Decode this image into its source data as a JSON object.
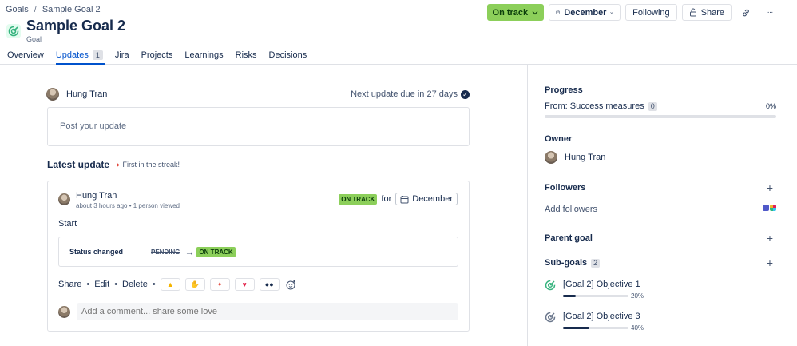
{
  "breadcrumb": {
    "root": "Goals",
    "separator": "/",
    "current": "Sample Goal 2"
  },
  "header": {
    "title": "Sample Goal 2",
    "subtitle": "Goal",
    "status_label": "On track",
    "month_label": "December",
    "following_label": "Following",
    "share_label": "Share",
    "more_label": "···"
  },
  "tabs": [
    {
      "label": "Overview"
    },
    {
      "label": "Updates",
      "count": "1"
    },
    {
      "label": "Jira"
    },
    {
      "label": "Projects"
    },
    {
      "label": "Learnings"
    },
    {
      "label": "Risks"
    },
    {
      "label": "Decisions"
    }
  ],
  "updates": {
    "user_name": "Hung Tran",
    "next_due": "Next update due in 27 days",
    "post_placeholder": "Post your update",
    "latest_title": "Latest update",
    "streak": "First in the streak!",
    "card": {
      "user_name": "Hung Tran",
      "meta": "about 3 hours ago • 1 person viewed",
      "status": "ON TRACK",
      "for_label": "for",
      "month": "December",
      "text": "Start",
      "status_change_label": "Status changed",
      "from_status": "PENDING",
      "to_status": "ON TRACK",
      "actions": {
        "share": "Share",
        "edit": "Edit",
        "delete": "Delete",
        "sep": "•"
      },
      "comment_placeholder": "Add a comment... share some love"
    }
  },
  "sidebar": {
    "progress": {
      "title": "Progress",
      "source": "From: Success measures",
      "count": "0",
      "percent": "0%",
      "value": 0
    },
    "owner": {
      "title": "Owner",
      "name": "Hung Tran"
    },
    "followers": {
      "title": "Followers",
      "add": "Add followers",
      "plus": "+"
    },
    "parent_goal": {
      "title": "Parent goal",
      "plus": "+"
    },
    "sub_goals": {
      "title": "Sub-goals",
      "count": "2",
      "plus": "+",
      "items": [
        {
          "name": "[Goal 2] Objective 1",
          "percent": "20%",
          "value": 0.2
        },
        {
          "name": "[Goal 2] Objective 3",
          "percent": "40%",
          "value": 0.4
        }
      ]
    }
  },
  "colors": {
    "on_track": "#8ccf5a",
    "accent": "#0052cc",
    "text": "#172b4d"
  }
}
